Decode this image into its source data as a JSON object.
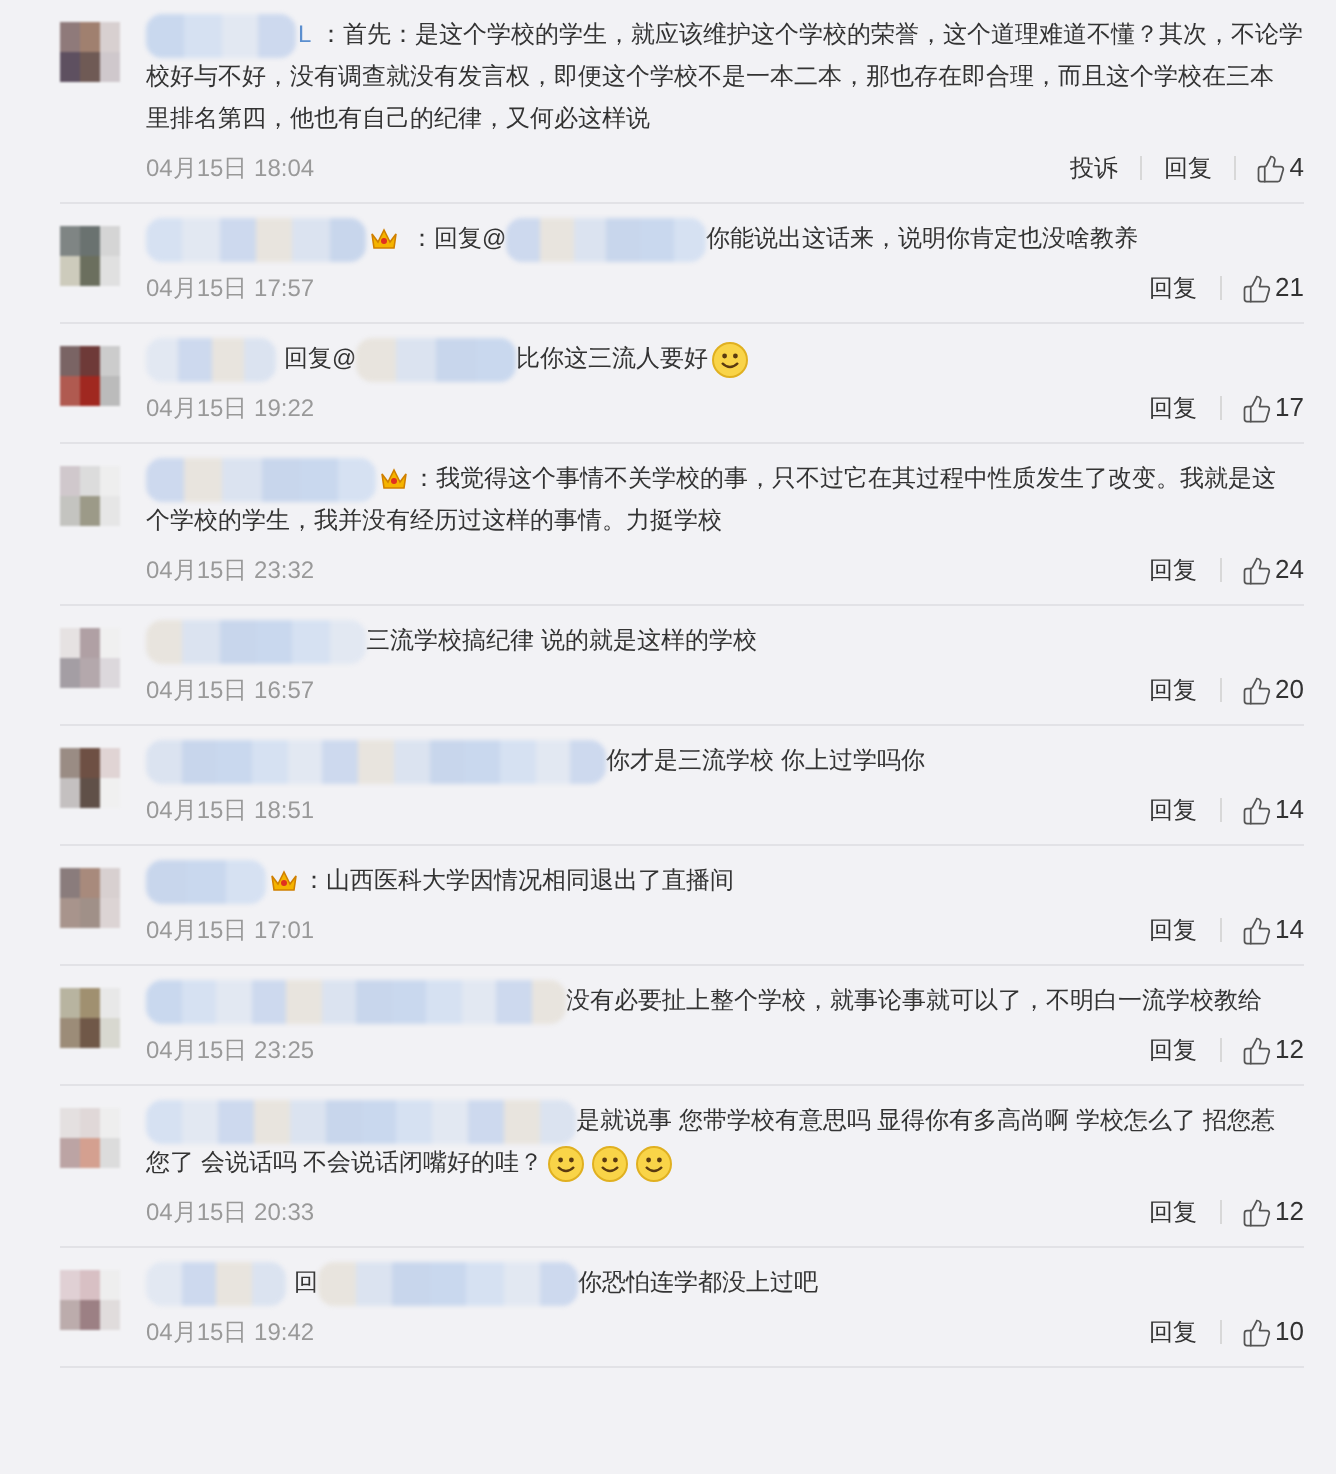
{
  "comments": [
    {
      "name_fragment": "L",
      "vip": false,
      "text_lines": [
        "：首先：是这个学校的学生，就应该维护这个学校的荣誉，这个道理难道不懂？其次，不论学",
        "校好与不好，没有调查就没有发言权，即便这个学校不是一本二本，那也存在即合理，而且这个学校在三本",
        "里排名第四，他也有自己的纪律，又何必这样说"
      ],
      "time": "04月15日 18:04",
      "actions": [
        "投诉",
        "回复"
      ],
      "likes": "4"
    },
    {
      "vip": true,
      "reply_prefix": "：回复@",
      "text_lines": [
        "你能说出这话来，说明你肯定也没啥教养"
      ],
      "time": "04月15日 17:57",
      "actions": [
        "回复"
      ],
      "likes": "21"
    },
    {
      "vip": false,
      "reply_prefix": "回复@",
      "text_lines": [
        "比你这三流人要好"
      ],
      "emojis": [
        {
          "kind": "smile"
        }
      ],
      "time": "04月15日 19:22",
      "actions": [
        "回复"
      ],
      "likes": "17"
    },
    {
      "vip": true,
      "text_lines": [
        "：我觉得这个事情不关学校的事，只不过它在其过程中性质发生了改变。我就是这",
        "个学校的学生，我并没有经历过这样的事情。力挺学校"
      ],
      "time": "04月15日 23:32",
      "actions": [
        "回复"
      ],
      "likes": "24"
    },
    {
      "vip": false,
      "text_lines": [
        "三流学校搞纪律 说的就是这样的学校"
      ],
      "time": "04月15日 16:57",
      "actions": [
        "回复"
      ],
      "likes": "20"
    },
    {
      "vip": false,
      "text_lines": [
        "你才是三流学校 你上过学吗你"
      ],
      "time": "04月15日 18:51",
      "actions": [
        "回复"
      ],
      "likes": "14"
    },
    {
      "vip": true,
      "text_lines": [
        "：山西医科大学因情况相同退出了直播间"
      ],
      "time": "04月15日 17:01",
      "actions": [
        "回复"
      ],
      "likes": "14"
    },
    {
      "vip": false,
      "text_lines": [
        "没有必要扯上整个学校，就事论事就可以了，不明白一流学校教给"
      ],
      "time": "04月15日 23:25",
      "actions": [
        "回复"
      ],
      "likes": "12"
    },
    {
      "vip": false,
      "text_lines": [
        "是就说事 您带学校有意思吗 显得你有多高尚啊 学校怎么了 招您惹",
        "您了 会说话吗 不会说话闭嘴好的哇？"
      ],
      "emojis": [
        {
          "kind": "smile"
        },
        {
          "kind": "smile"
        },
        {
          "kind": "smile"
        }
      ],
      "time": "04月15日 20:33",
      "actions": [
        "回复"
      ],
      "likes": "12"
    },
    {
      "vip": false,
      "reply_prefix": "回",
      "text_lines": [
        "你恐怕连学都没上过吧"
      ],
      "time": "04月15日 19:42",
      "actions": [
        "回复"
      ],
      "likes": "10"
    }
  ]
}
